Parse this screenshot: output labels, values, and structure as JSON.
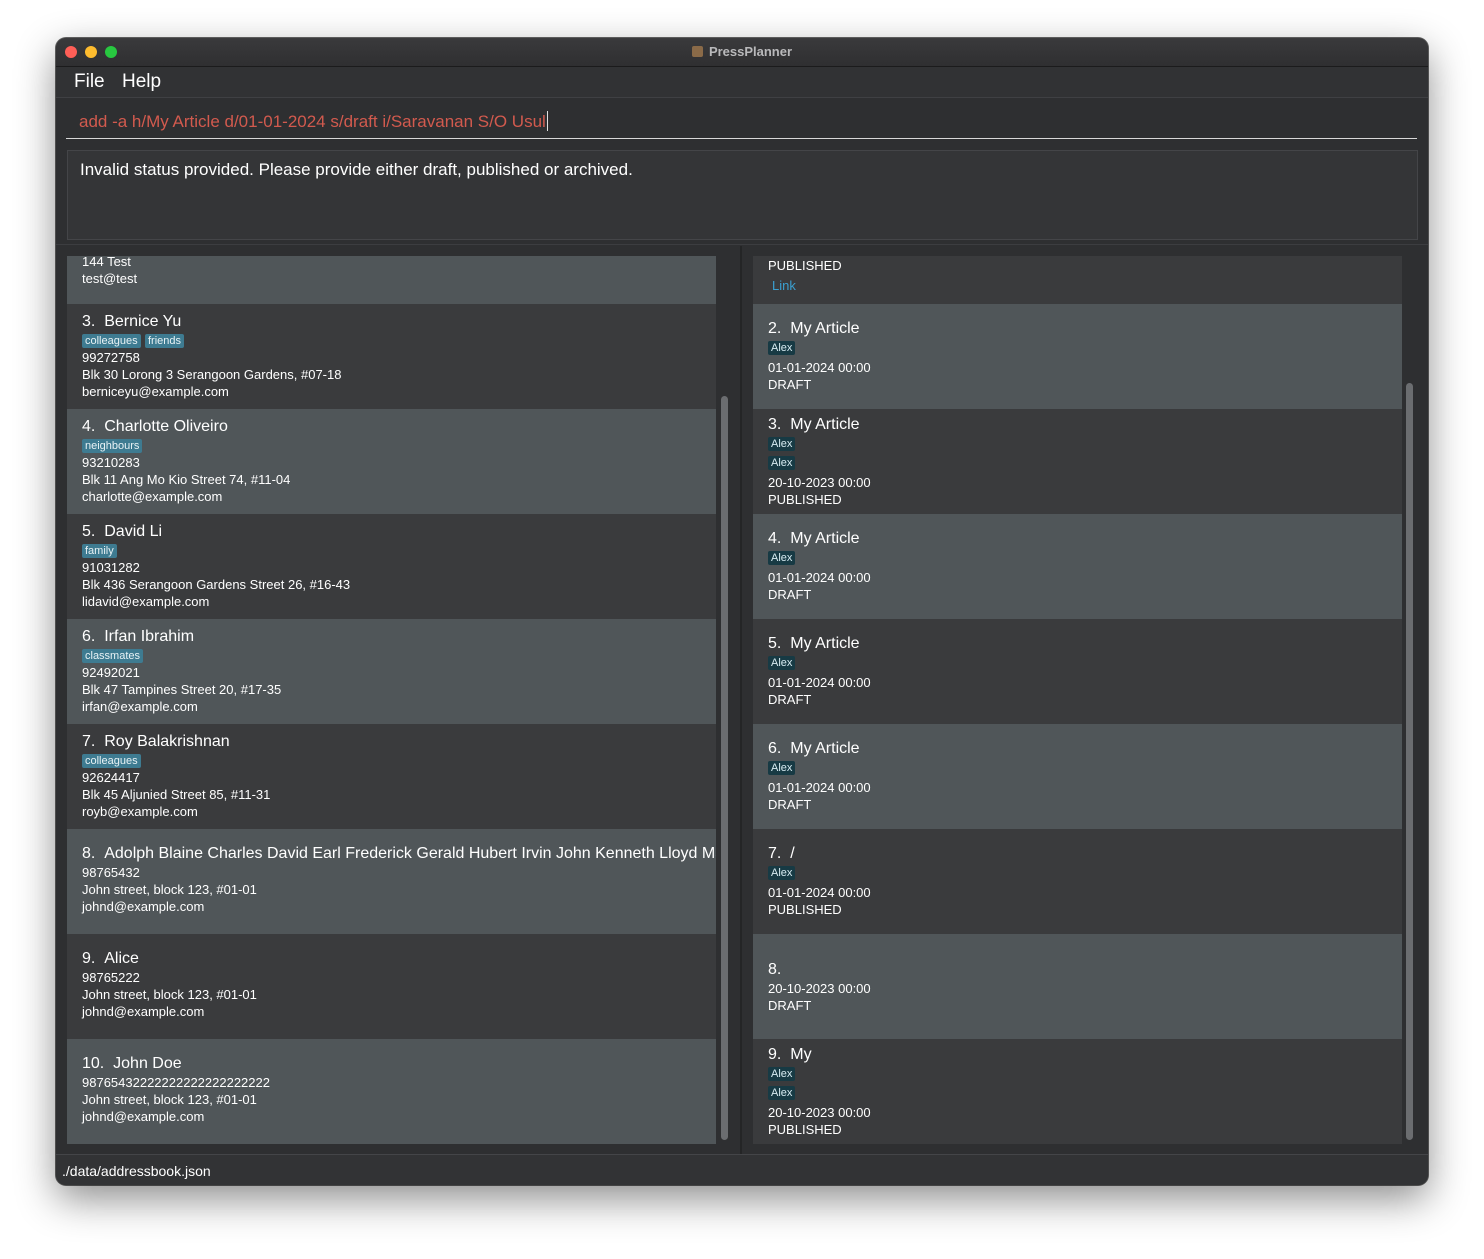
{
  "window": {
    "title": "PressPlanner"
  },
  "menu": {
    "file": "File",
    "help": "Help"
  },
  "command": {
    "value": "add -a h/My Article d/01-01-2024 s/draft i/Saravanan S/O Usul"
  },
  "result": {
    "message": "Invalid status provided. Please provide either draft, published or archived."
  },
  "persons": [
    {
      "lines": [
        "144 Test",
        "test@test"
      ]
    },
    {
      "index": "3.",
      "name": "Bernice Yu",
      "tags": [
        "colleagues",
        "friends"
      ],
      "phone": "99272758",
      "address": "Blk 30 Lorong 3 Serangoon Gardens, #07-18",
      "email": "berniceyu@example.com"
    },
    {
      "index": "4.",
      "name": "Charlotte Oliveiro",
      "tags": [
        "neighbours"
      ],
      "phone": "93210283",
      "address": "Blk 11 Ang Mo Kio Street 74, #11-04",
      "email": "charlotte@example.com"
    },
    {
      "index": "5.",
      "name": "David Li",
      "tags": [
        "family"
      ],
      "phone": "91031282",
      "address": "Blk 436 Serangoon Gardens Street 26, #16-43",
      "email": "lidavid@example.com"
    },
    {
      "index": "6.",
      "name": "Irfan Ibrahim",
      "tags": [
        "classmates"
      ],
      "phone": "92492021",
      "address": "Blk 47 Tampines Street 20, #17-35",
      "email": "irfan@example.com"
    },
    {
      "index": "7.",
      "name": "Roy Balakrishnan",
      "tags": [
        "colleagues"
      ],
      "phone": "92624417",
      "address": "Blk 45 Aljunied Street 85, #11-31",
      "email": "royb@example.com"
    },
    {
      "index": "8.",
      "name": "Adolph Blaine Charles David Earl Frederick Gerald Hubert Irvin John Kenneth Lloyd Marti...",
      "phone": "98765432",
      "address": "John street, block 123, #01-01",
      "email": "johnd@example.com"
    },
    {
      "index": "9.",
      "name": "Alice",
      "phone": "98765222",
      "address": "John street, block 123, #01-01",
      "email": "johnd@example.com"
    },
    {
      "index": "10.",
      "name": "John Doe",
      "phone": "98765432222222222222222222",
      "address": "John street, block 123, #01-01",
      "email": "johnd@example.com"
    }
  ],
  "articles": [
    {
      "status": "PUBLISHED",
      "link": "Link"
    },
    {
      "index": "2.",
      "title": "My Article",
      "authors": [
        "Alex"
      ],
      "date": "01-01-2024 00:00",
      "status": "DRAFT"
    },
    {
      "index": "3.",
      "title": "My Article",
      "authors": [
        "Alex",
        "Alex"
      ],
      "date": "20-10-2023 00:00",
      "status": "PUBLISHED"
    },
    {
      "index": "4.",
      "title": "My Article",
      "authors": [
        "Alex"
      ],
      "date": "01-01-2024 00:00",
      "status": "DRAFT"
    },
    {
      "index": "5.",
      "title": "My Article",
      "authors": [
        "Alex"
      ],
      "date": "01-01-2024 00:00",
      "status": "DRAFT"
    },
    {
      "index": "6.",
      "title": "My Article",
      "authors": [
        "Alex"
      ],
      "date": "01-01-2024 00:00",
      "status": "DRAFT"
    },
    {
      "index": "7.",
      "title": "/",
      "authors": [
        "Alex"
      ],
      "date": "01-01-2024 00:00",
      "status": "PUBLISHED"
    },
    {
      "index": "8.",
      "title": "",
      "date": "20-10-2023 00:00",
      "status": "DRAFT"
    },
    {
      "index": "9.",
      "title": "My",
      "authors": [
        "Alex",
        "Alex"
      ],
      "date": "20-10-2023 00:00",
      "status": "PUBLISHED"
    }
  ],
  "status_bar": {
    "path": "./data/addressbook.json"
  },
  "colors": {
    "command_text": "#d25a4e",
    "tag_bg": "#3e7b91",
    "author_tag_bg": "#173a44",
    "link": "#3a9fd0"
  }
}
